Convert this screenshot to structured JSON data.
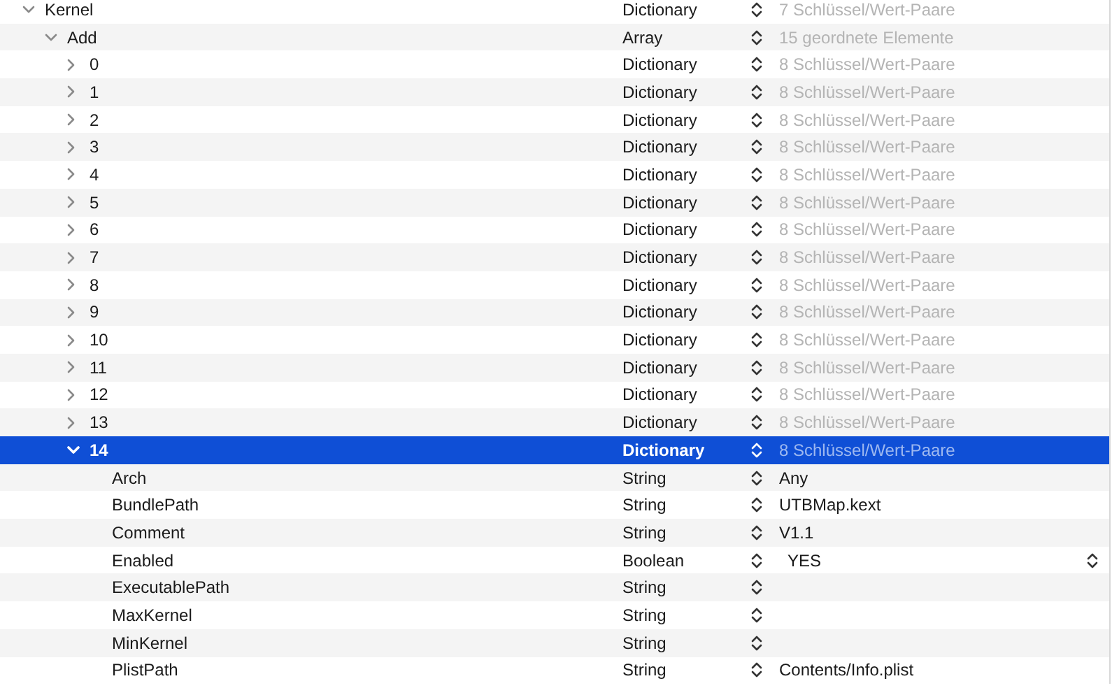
{
  "tree": [
    {
      "key": "Kernel",
      "type": "Dictionary",
      "value": "7 Schlüssel/Wert-Paare",
      "kind": "summary",
      "expanded": true,
      "selected": false,
      "children": [
        {
          "key": "Add",
          "type": "Array",
          "value": "15 geordnete Elemente",
          "kind": "summary",
          "expanded": true,
          "selected": false,
          "children": [
            {
              "key": "0",
              "type": "Dictionary",
              "value": "8 Schlüssel/Wert-Paare",
              "kind": "summary",
              "expanded": false,
              "selected": false
            },
            {
              "key": "1",
              "type": "Dictionary",
              "value": "8 Schlüssel/Wert-Paare",
              "kind": "summary",
              "expanded": false,
              "selected": false
            },
            {
              "key": "2",
              "type": "Dictionary",
              "value": "8 Schlüssel/Wert-Paare",
              "kind": "summary",
              "expanded": false,
              "selected": false
            },
            {
              "key": "3",
              "type": "Dictionary",
              "value": "8 Schlüssel/Wert-Paare",
              "kind": "summary",
              "expanded": false,
              "selected": false
            },
            {
              "key": "4",
              "type": "Dictionary",
              "value": "8 Schlüssel/Wert-Paare",
              "kind": "summary",
              "expanded": false,
              "selected": false
            },
            {
              "key": "5",
              "type": "Dictionary",
              "value": "8 Schlüssel/Wert-Paare",
              "kind": "summary",
              "expanded": false,
              "selected": false
            },
            {
              "key": "6",
              "type": "Dictionary",
              "value": "8 Schlüssel/Wert-Paare",
              "kind": "summary",
              "expanded": false,
              "selected": false
            },
            {
              "key": "7",
              "type": "Dictionary",
              "value": "8 Schlüssel/Wert-Paare",
              "kind": "summary",
              "expanded": false,
              "selected": false
            },
            {
              "key": "8",
              "type": "Dictionary",
              "value": "8 Schlüssel/Wert-Paare",
              "kind": "summary",
              "expanded": false,
              "selected": false
            },
            {
              "key": "9",
              "type": "Dictionary",
              "value": "8 Schlüssel/Wert-Paare",
              "kind": "summary",
              "expanded": false,
              "selected": false
            },
            {
              "key": "10",
              "type": "Dictionary",
              "value": "8 Schlüssel/Wert-Paare",
              "kind": "summary",
              "expanded": false,
              "selected": false
            },
            {
              "key": "11",
              "type": "Dictionary",
              "value": "8 Schlüssel/Wert-Paare",
              "kind": "summary",
              "expanded": false,
              "selected": false
            },
            {
              "key": "12",
              "type": "Dictionary",
              "value": "8 Schlüssel/Wert-Paare",
              "kind": "summary",
              "expanded": false,
              "selected": false
            },
            {
              "key": "13",
              "type": "Dictionary",
              "value": "8 Schlüssel/Wert-Paare",
              "kind": "summary",
              "expanded": false,
              "selected": false
            },
            {
              "key": "14",
              "type": "Dictionary",
              "value": "8 Schlüssel/Wert-Paare",
              "kind": "summary",
              "expanded": true,
              "selected": true,
              "children": [
                {
                  "key": "Arch",
                  "type": "String",
                  "value": "Any",
                  "kind": "text",
                  "selected": false
                },
                {
                  "key": "BundlePath",
                  "type": "String",
                  "value": "UTBMap.kext",
                  "kind": "text",
                  "selected": false
                },
                {
                  "key": "Comment",
                  "type": "String",
                  "value": "V1.1",
                  "kind": "text",
                  "selected": false
                },
                {
                  "key": "Enabled",
                  "type": "Boolean",
                  "value": "YES",
                  "kind": "popup",
                  "selected": false
                },
                {
                  "key": "ExecutablePath",
                  "type": "String",
                  "kind": "text",
                  "selected": false
                },
                {
                  "key": "MaxKernel",
                  "type": "String",
                  "kind": "text",
                  "selected": false
                },
                {
                  "key": "MinKernel",
                  "type": "String",
                  "kind": "text",
                  "selected": false
                },
                {
                  "key": "PlistPath",
                  "type": "String",
                  "value": "Contents/Info.plist",
                  "kind": "text",
                  "selected": false
                }
              ]
            }
          ]
        }
      ]
    }
  ]
}
